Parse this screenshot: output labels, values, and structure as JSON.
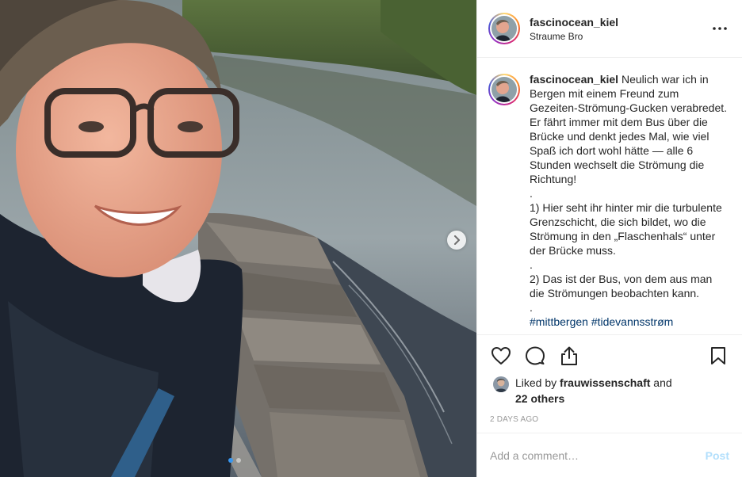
{
  "post": {
    "username": "fascinocean_kiel",
    "location": "Straume Bro",
    "more_icon": "more-horizontal-icon"
  },
  "caption": {
    "username": "fascinocean_kiel",
    "text": " Neulich war ich in Bergen mit einem Freund zum Gezeiten-Strömung-Gucken verabredet. Er fährt immer mit dem Bus über die Brücke und denkt jedes Mal, wie viel Spaß ich dort wohl hätte — alle 6 Stunden wechselt die Strömung die Richtung!\n.\n1) Hier seht ihr hinter mir die turbulente Grenzschicht, die sich bildet, wo die Strömung in den „Flaschenhals“ unter der Brücke muss.\n.\n2) Das ist der Bus, von dem aus man die Strömungen beobachten kann.\n.\n",
    "hashtag1": "#mittbergen",
    "hashtag2": "#tidevannsstrøm"
  },
  "likes": {
    "prefix": "Liked by ",
    "user": "frauwissenschaft",
    "middle": " and",
    "others": "22 others"
  },
  "timestamp": "2 DAYS AGO",
  "comment": {
    "placeholder": "Add a comment…",
    "post_label": "Post"
  },
  "carousel": {
    "current": 1,
    "total": 2
  },
  "colors": {
    "link": "#003569",
    "post_disabled": "#b2dffc",
    "carousel_active": "#3897f0",
    "divider": "#efefef"
  }
}
